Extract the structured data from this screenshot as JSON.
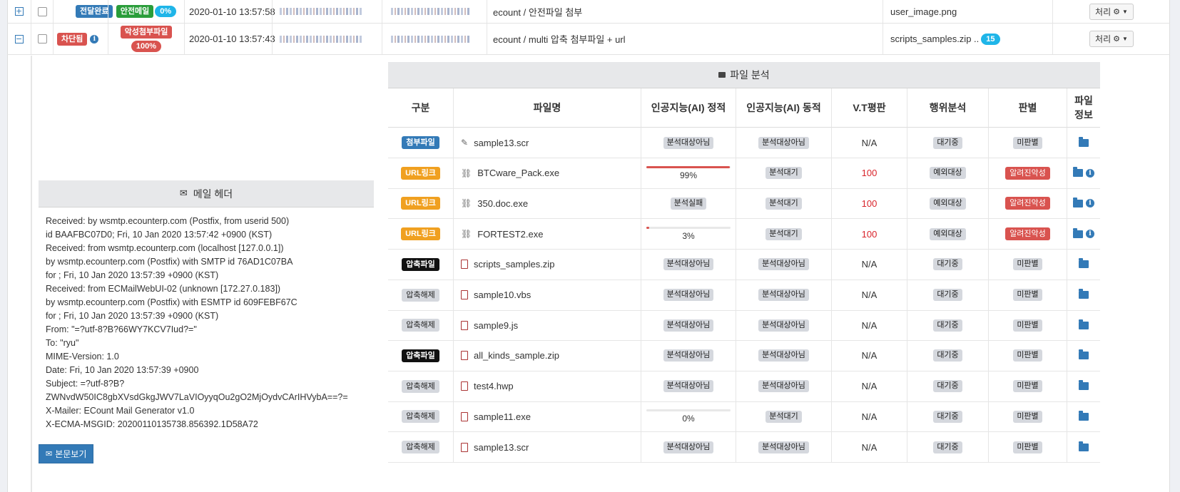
{
  "colors": {
    "primary": "#337ab7",
    "danger": "#d9534f",
    "success": "#2a9d3a",
    "warning": "#f0a020",
    "info": "#1fb5e8"
  },
  "mail_rows": [
    {
      "expander": "+",
      "status": "전달완료",
      "verdict": "안전메일",
      "score": "0%",
      "datetime": "2020-01-10 13:57:58",
      "subject": "ecount / 안전파일 첨부",
      "attachment": "user_image.png",
      "action": "처리"
    },
    {
      "expander": "−",
      "status": "차단됨",
      "verdict": "악성첨부파일",
      "score": "100%",
      "datetime": "2020-01-10 13:57:43",
      "subject": "ecount / multi 압축 첨부파일 + url",
      "attachment": "scripts_samples.zip ..",
      "attachment_count": "15",
      "action": "처리"
    }
  ],
  "mail_header": {
    "title": "메일 헤더",
    "lines": [
      "Received: by wsmtp.ecounterp.com (Postfix, from userid 500)",
      "id BAAFBC07D0; Fri, 10 Jan 2020 13:57:42 +0900 (KST)",
      "Received: from wsmtp.ecounterp.com (localhost [127.0.0.1])",
      "by wsmtp.ecounterp.com (Postfix) with SMTP id 76AD1C07BA",
      "for ; Fri, 10 Jan 2020 13:57:39 +0900 (KST)",
      "Received: from ECMailWebUI-02 (unknown [172.27.0.183])",
      "by wsmtp.ecounterp.com (Postfix) with ESMTP id 609FEBF67C",
      "for ; Fri, 10 Jan 2020 13:57:39 +0900 (KST)",
      "From: \"=?utf-8?B?66WY7KCV7Iud?=\"",
      "To: \"ryu\"",
      "MIME-Version: 1.0",
      "Date: Fri, 10 Jan 2020 13:57:39 +0900",
      "Subject: =?utf-8?B?",
      "ZWNvdW50IC8gbXVsdGkgJWV7LaVIOyyqOu2gO2MjOydvCArIHVybA==?=",
      "X-Mailer: ECount Mail Generator v1.0",
      "X-ECMA-MSGID: 20200110135738.856392.1D58A72"
    ],
    "view_body_button": "본문보기"
  },
  "file_analysis": {
    "title": "파일 분석",
    "columns": [
      "구분",
      "파일명",
      "인공지능(AI) 정적",
      "인공지능(AI) 동적",
      "V.T평판",
      "행위분석",
      "판별",
      "파일 정보"
    ],
    "rows": [
      {
        "type": "첨부파일",
        "type_color": "blue",
        "icon": "paperclip",
        "name": "sample13.scr",
        "ai_static": "분석대상아님",
        "ai_dynamic": "분석대상아님",
        "vt": "N/A",
        "behavior": "대기중",
        "verdict": "미판별",
        "verdict_color": "gray",
        "info": false
      },
      {
        "type": "URL링크",
        "type_color": "orange",
        "icon": "link",
        "name": "BTCware_Pack.exe",
        "ai_static_progress": 0.99,
        "ai_static": "99%",
        "ai_dynamic": "분석대기",
        "vt": "100",
        "behavior": "예외대상",
        "verdict": "알려진악성",
        "verdict_color": "red",
        "info": true
      },
      {
        "type": "URL링크",
        "type_color": "orange",
        "icon": "link",
        "name": "350.doc.exe",
        "ai_static": "분석실패",
        "ai_dynamic": "분석대기",
        "vt": "100",
        "behavior": "예외대상",
        "verdict": "알려진악성",
        "verdict_color": "red",
        "info": true
      },
      {
        "type": "URL링크",
        "type_color": "orange",
        "icon": "link",
        "name": "FORTEST2.exe",
        "ai_static_progress": 0.03,
        "ai_static": "3%",
        "ai_dynamic": "분석대기",
        "vt": "100",
        "behavior": "예외대상",
        "verdict": "알려진악성",
        "verdict_color": "red",
        "info": true
      },
      {
        "type": "압축파일",
        "type_color": "black",
        "icon": "zip-file",
        "name": "scripts_samples.zip",
        "ai_static": "분석대상아님",
        "ai_dynamic": "분석대상아님",
        "vt": "N/A",
        "behavior": "대기중",
        "verdict": "미판별",
        "verdict_color": "gray",
        "info": false
      },
      {
        "type": "압축해제",
        "type_color": "gray",
        "icon": "zip-file",
        "name": "sample10.vbs",
        "ai_static": "분석대상아님",
        "ai_dynamic": "분석대상아님",
        "vt": "N/A",
        "behavior": "대기중",
        "verdict": "미판별",
        "verdict_color": "gray",
        "info": false
      },
      {
        "type": "압축해제",
        "type_color": "gray",
        "icon": "zip-file",
        "name": "sample9.js",
        "ai_static": "분석대상아님",
        "ai_dynamic": "분석대상아님",
        "vt": "N/A",
        "behavior": "대기중",
        "verdict": "미판별",
        "verdict_color": "gray",
        "info": false
      },
      {
        "type": "압축파일",
        "type_color": "black",
        "icon": "zip-file",
        "name": "all_kinds_sample.zip",
        "ai_static": "분석대상아님",
        "ai_dynamic": "분석대상아님",
        "vt": "N/A",
        "behavior": "대기중",
        "verdict": "미판별",
        "verdict_color": "gray",
        "info": false
      },
      {
        "type": "압축해제",
        "type_color": "gray",
        "icon": "zip-file",
        "name": "test4.hwp",
        "ai_static": "분석대상아님",
        "ai_dynamic": "분석대상아님",
        "vt": "N/A",
        "behavior": "대기중",
        "verdict": "미판별",
        "verdict_color": "gray",
        "info": false
      },
      {
        "type": "압축해제",
        "type_color": "gray",
        "icon": "zip-file",
        "name": "sample11.exe",
        "ai_static_progress": 0,
        "ai_static": "0%",
        "ai_dynamic": "분석대기",
        "vt": "N/A",
        "behavior": "대기중",
        "verdict": "미판별",
        "verdict_color": "gray",
        "info": false
      },
      {
        "type": "압축해제",
        "type_color": "gray",
        "icon": "zip-file",
        "name": "sample13.scr",
        "ai_static": "분석대상아님",
        "ai_dynamic": "분석대상아님",
        "vt": "N/A",
        "behavior": "대기중",
        "verdict": "미판별",
        "verdict_color": "gray",
        "info": false
      }
    ]
  }
}
